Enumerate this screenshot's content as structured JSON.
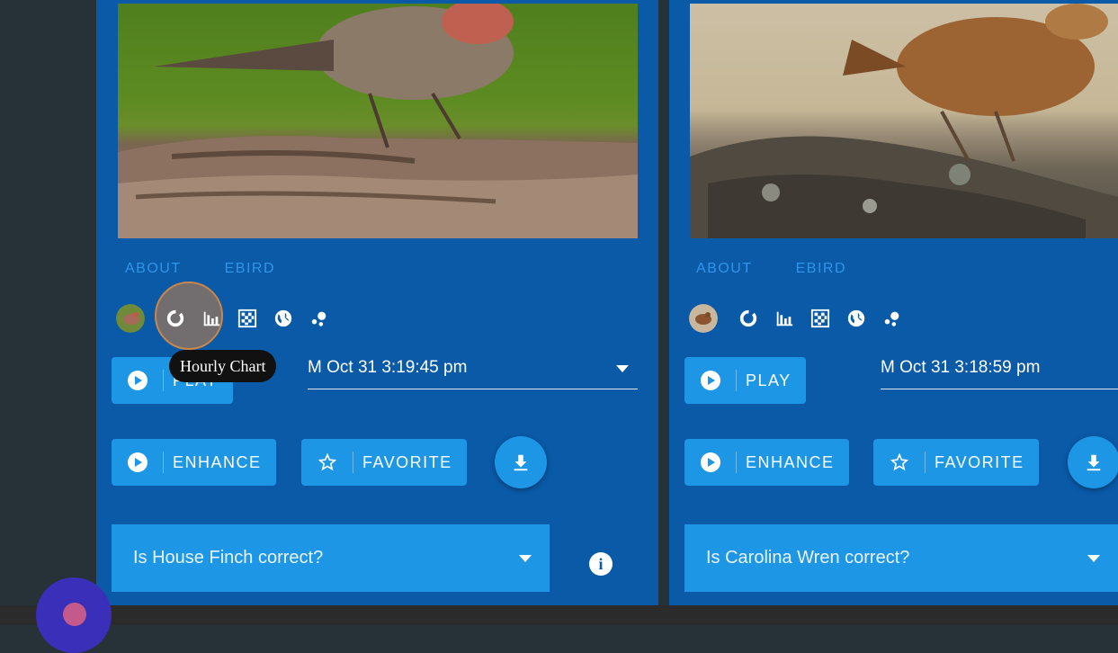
{
  "cards": [
    {
      "links": {
        "about": "ABOUT",
        "ebird": "EBIRD"
      },
      "timestamp": "M Oct 31 3:19:45 pm",
      "buttons": {
        "play": "PLAY",
        "enhance": "ENHANCE",
        "favorite": "FAVORITE"
      },
      "question": "Is House Finch correct?",
      "tooltip": "Hourly Chart"
    },
    {
      "links": {
        "about": "ABOUT",
        "ebird": "EBIRD"
      },
      "timestamp": "M Oct 31 3:18:59 pm",
      "buttons": {
        "play": "PLAY",
        "enhance": "ENHANCE",
        "favorite": "FAVORITE"
      },
      "question": "Is Carolina Wren correct?"
    }
  ],
  "icons": [
    "species-avatar",
    "hourly-chart-icon",
    "bar-chart-icon",
    "grid-icon",
    "globe-icon",
    "scatter-icon",
    "play-icon",
    "star-icon",
    "download-icon",
    "dropdown-caret-icon",
    "info-icon"
  ],
  "colors": {
    "card": "#0a5aa8",
    "button": "#1e96e6",
    "background": "#263238",
    "link": "#2f95e8",
    "tooltip": "#111111"
  }
}
